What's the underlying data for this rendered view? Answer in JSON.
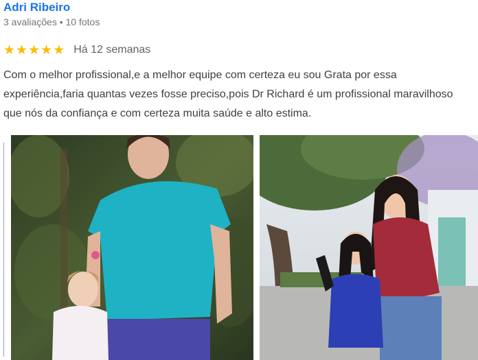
{
  "reviewer": {
    "name": "Adri Ribeiro",
    "meta": "3 avaliações • 10 fotos"
  },
  "rating": {
    "stars": 5,
    "star_glyph": "★",
    "date": "Há 12 semanas",
    "star_color": "#fbbc04"
  },
  "review": {
    "text": "Com o melhor profissional,e a melhor equipe com certeza eu sou Grata por essa experiência,faria quantas vezes fosse preciso,pois Dr Richard é um profissional maravilhoso que nós da confiança e com certeza muita saúde e alto estima."
  },
  "photos": [
    {
      "kind": "before-photo"
    },
    {
      "kind": "after-photo"
    }
  ],
  "colors": {
    "name_link": "#1a73e8",
    "meta": "#70757a",
    "body_text": "#3c4043"
  }
}
